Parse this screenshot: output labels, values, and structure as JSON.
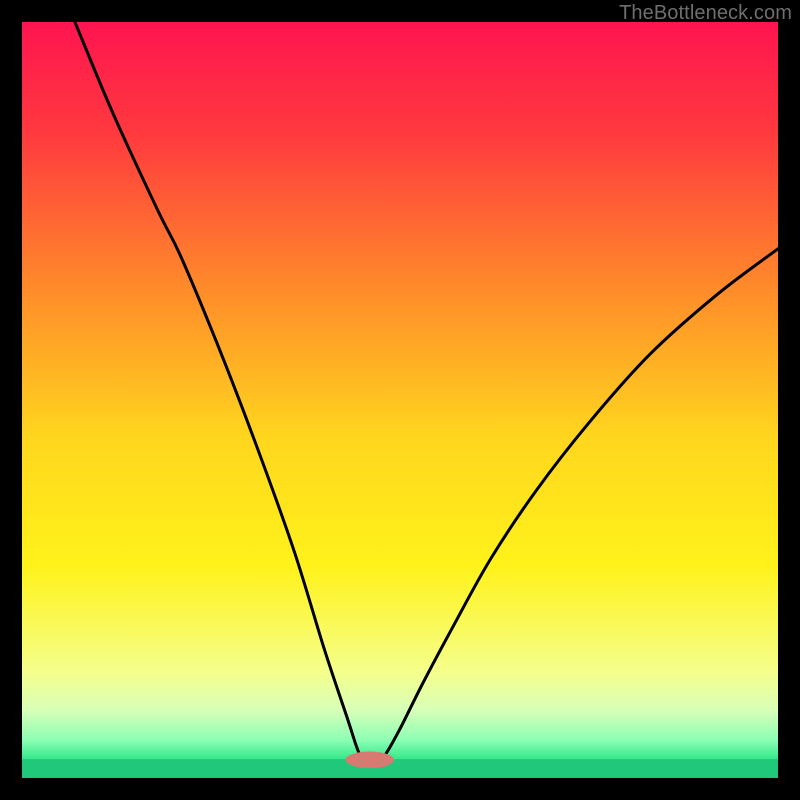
{
  "watermark": "TheBottleneck.com",
  "chart_data": {
    "type": "line",
    "title": "",
    "xlabel": "",
    "ylabel": "",
    "xlim": [
      0,
      100
    ],
    "ylim": [
      0,
      100
    ],
    "grid": false,
    "legend": false,
    "background_gradient_stops": [
      {
        "offset": 0.0,
        "color": "#ff1450"
      },
      {
        "offset": 0.15,
        "color": "#ff3a3e"
      },
      {
        "offset": 0.35,
        "color": "#ff8a2a"
      },
      {
        "offset": 0.55,
        "color": "#ffd61e"
      },
      {
        "offset": 0.72,
        "color": "#fff21a"
      },
      {
        "offset": 0.86,
        "color": "#f5ff8c"
      },
      {
        "offset": 0.91,
        "color": "#d8ffb8"
      },
      {
        "offset": 0.95,
        "color": "#8cffb4"
      },
      {
        "offset": 0.975,
        "color": "#35e88a"
      },
      {
        "offset": 1.0,
        "color": "#14d47a"
      }
    ],
    "bottom_band": {
      "y": 97.5,
      "color": "#20c87a"
    },
    "marker": {
      "x": 46,
      "y": 97.6,
      "rx": 3.2,
      "ry": 1.1,
      "color": "#d77a72"
    },
    "series": [
      {
        "name": "bottleneck-curve",
        "color": "#000000",
        "points": [
          {
            "x": 7.0,
            "y": 0.0
          },
          {
            "x": 12.0,
            "y": 12.0
          },
          {
            "x": 18.0,
            "y": 25.0
          },
          {
            "x": 21.0,
            "y": 31.0
          },
          {
            "x": 26.0,
            "y": 43.0
          },
          {
            "x": 31.0,
            "y": 56.0
          },
          {
            "x": 36.0,
            "y": 70.0
          },
          {
            "x": 40.0,
            "y": 83.0
          },
          {
            "x": 43.0,
            "y": 92.0
          },
          {
            "x": 44.5,
            "y": 96.5
          },
          {
            "x": 45.5,
            "y": 97.8
          },
          {
            "x": 47.0,
            "y": 97.8
          },
          {
            "x": 48.0,
            "y": 97.0
          },
          {
            "x": 50.0,
            "y": 93.5
          },
          {
            "x": 53.0,
            "y": 87.5
          },
          {
            "x": 57.0,
            "y": 80.0
          },
          {
            "x": 62.0,
            "y": 71.0
          },
          {
            "x": 68.0,
            "y": 62.0
          },
          {
            "x": 75.0,
            "y": 53.0
          },
          {
            "x": 83.0,
            "y": 44.0
          },
          {
            "x": 92.0,
            "y": 36.0
          },
          {
            "x": 100.0,
            "y": 30.0
          }
        ]
      }
    ]
  }
}
